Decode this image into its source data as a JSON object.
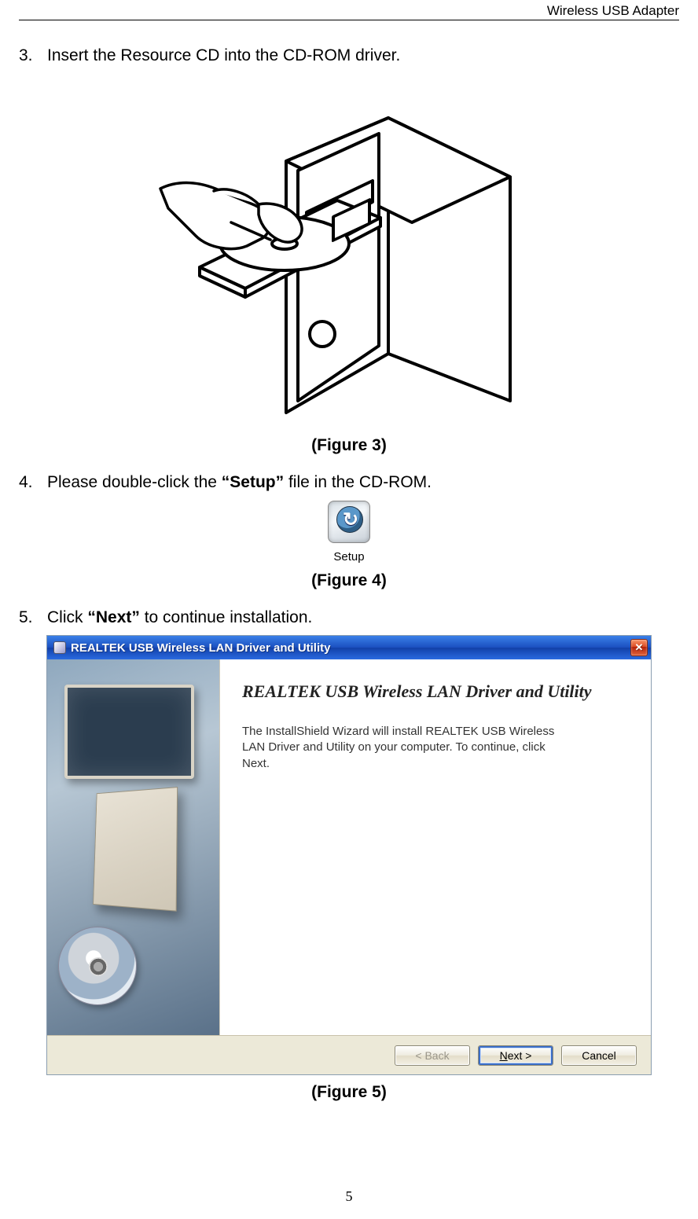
{
  "header": {
    "title": "Wireless USB Adapter"
  },
  "steps": {
    "s3": {
      "num": "3.",
      "text": "Insert the Resource CD into the CD-ROM driver."
    },
    "s4": {
      "num": "4.",
      "pre": "Please double-click the ",
      "bold": "“Setup”",
      "post": " file in the CD-ROM."
    },
    "s5": {
      "num": "5.",
      "pre": "Click ",
      "bold": "“Next”",
      "post": " to continue installation."
    }
  },
  "captions": {
    "fig3": "(Figure 3)",
    "fig4": "(Figure 4)",
    "fig5": "(Figure 5)"
  },
  "setup": {
    "label": "Setup"
  },
  "installer": {
    "title": "REALTEK USB Wireless LAN Driver and Utility",
    "heading": "REALTEK USB Wireless LAN Driver and Utility",
    "body": "The InstallShield Wizard will install REALTEK USB Wireless LAN Driver and Utility on your computer.  To continue, click Next.",
    "buttons": {
      "back": "< Back",
      "next": "Next >",
      "cancel": "Cancel"
    }
  },
  "page_number": "5"
}
